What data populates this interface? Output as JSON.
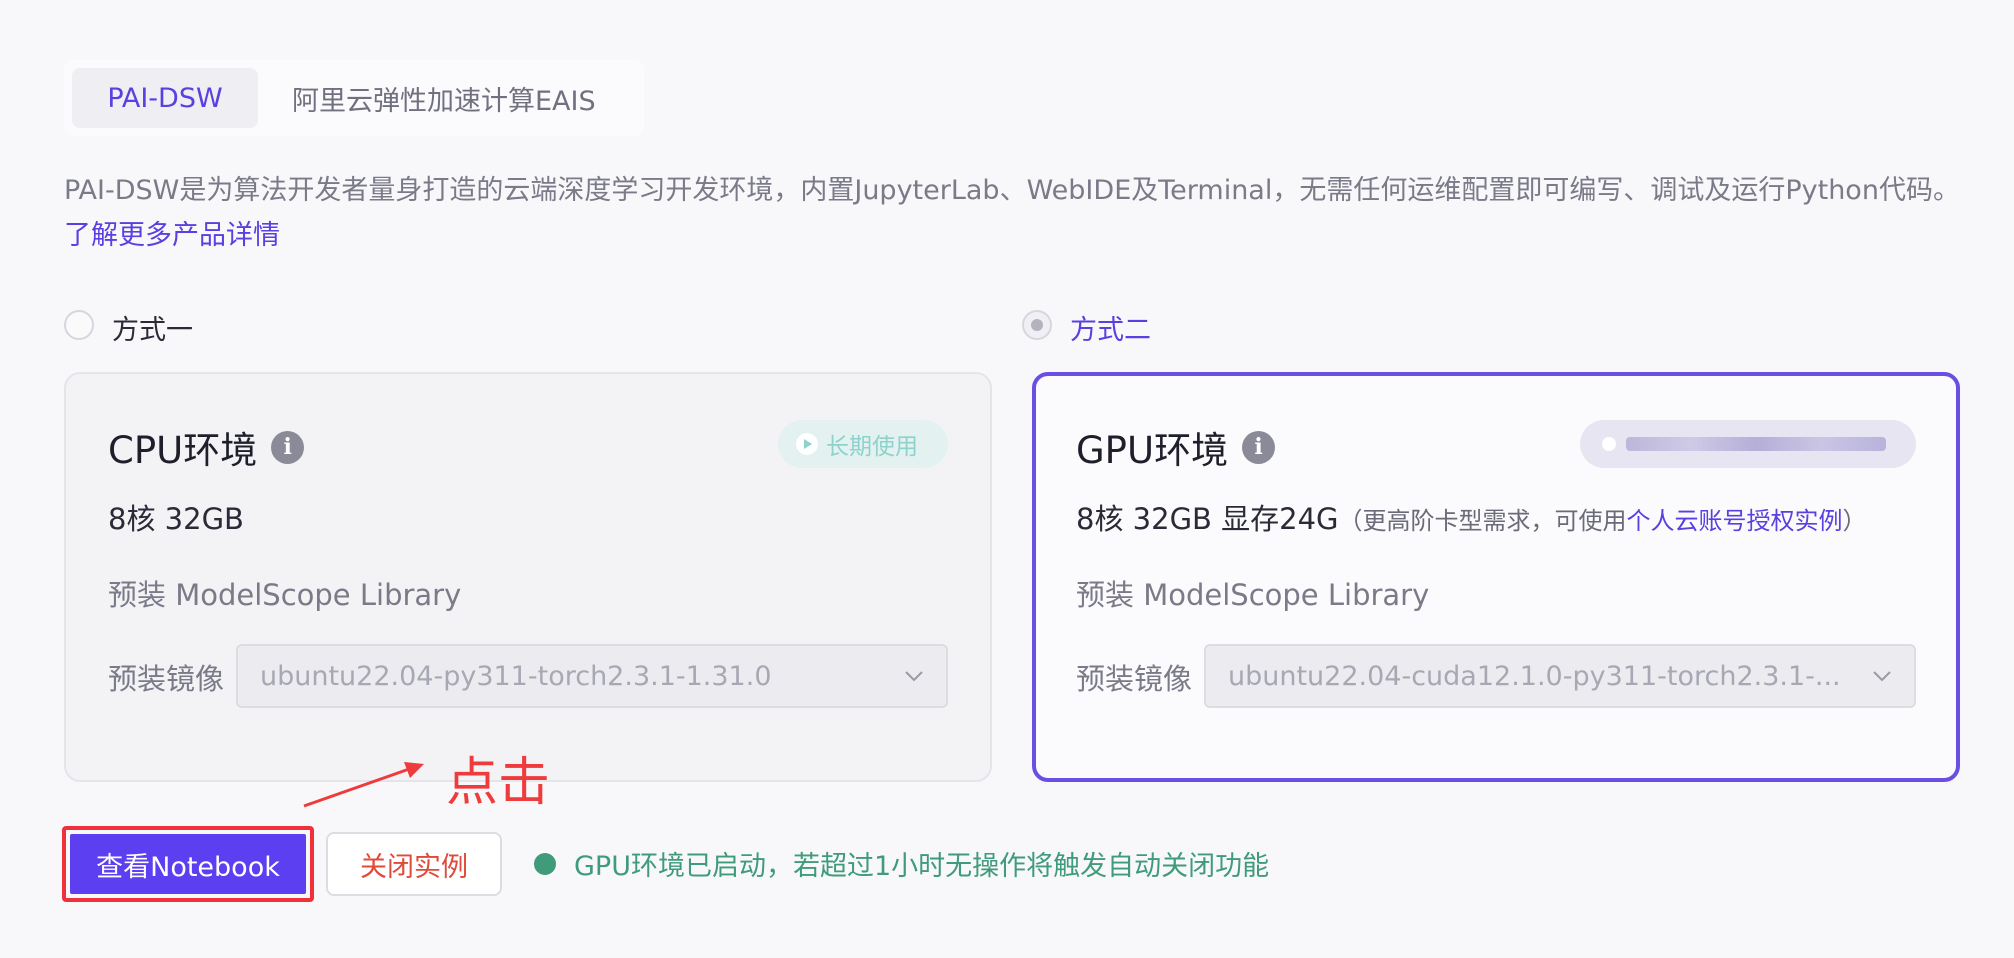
{
  "tabs": {
    "active": "PAI-DSW",
    "inactive": "阿里云弹性加速计算EAIS"
  },
  "description": {
    "text": "PAI-DSW是为算法开发者量身打造的云端深度学习开发环境，内置JupyterLab、WebIDE及Terminal，无需任何运维配置即可编写、调试及运行Python代码。",
    "link": "了解更多产品详情"
  },
  "options": [
    {
      "label": "方式一",
      "selected": false
    },
    {
      "label": "方式二",
      "selected": true
    }
  ],
  "cpu_card": {
    "title": "CPU环境",
    "badge": "长期使用",
    "spec": "8核 32GB",
    "library": "预装 ModelScope Library",
    "image_label": "预装镜像",
    "image_value": "ubuntu22.04-py311-torch2.3.1-1.31.0"
  },
  "gpu_card": {
    "title": "GPU环境",
    "spec": "8核 32GB 显存24G",
    "note_prefix": "（更高阶卡型需求，可使用",
    "note_link": "个人云账号授权实例",
    "note_suffix": "）",
    "library": "预装 ModelScope Library",
    "image_label": "预装镜像",
    "image_value": "ubuntu22.04-cuda12.1.0-py311-torch2.3.1-..."
  },
  "actions": {
    "view_notebook": "查看Notebook",
    "close_instance": "关闭实例",
    "status": "GPU环境已启动，若超过1小时无操作将触发自动关闭功能"
  },
  "annotation": {
    "text": "点击"
  },
  "colors": {
    "accent": "#5b3fe0",
    "status_green": "#3f9b7a",
    "danger": "#e04a3a",
    "annotation_red": "#ee3b3b"
  },
  "icons": [
    "info-icon",
    "play-circle-icon",
    "chevron-down-icon",
    "arrow-annotation-icon"
  ]
}
